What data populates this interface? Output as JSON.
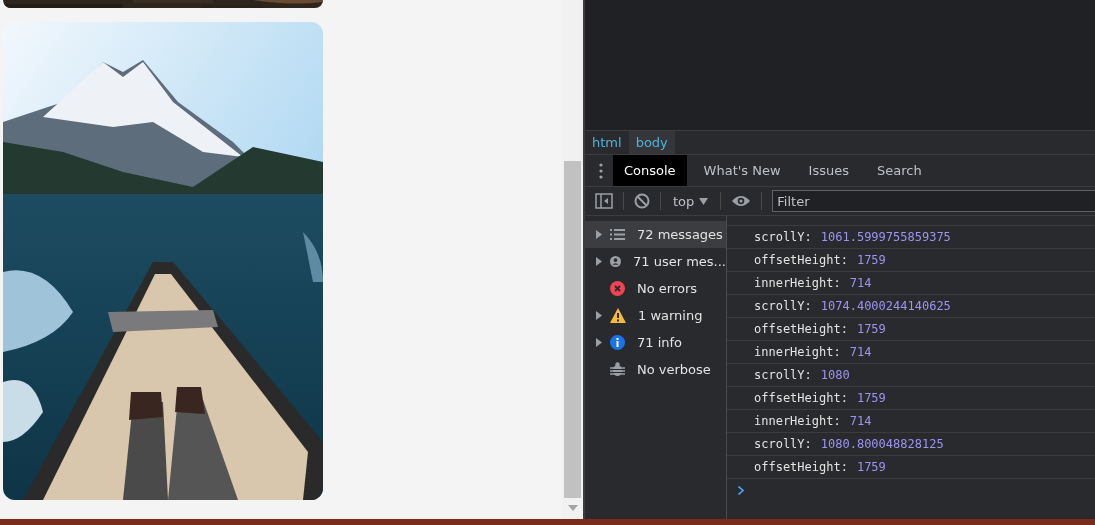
{
  "devtools": {
    "breadcrumbs": [
      {
        "label": "html",
        "selected": false
      },
      {
        "label": "body",
        "selected": true
      }
    ],
    "tabs": [
      {
        "label": "Console",
        "selected": true
      },
      {
        "label": "What's New",
        "selected": false
      },
      {
        "label": "Issues",
        "selected": false
      },
      {
        "label": "Search",
        "selected": false
      }
    ],
    "toolbar": {
      "context": "top",
      "filter_placeholder": "Filter"
    },
    "sidebar": [
      {
        "kind": "list",
        "label": "72 messages",
        "expandable": true,
        "selected": true
      },
      {
        "kind": "user",
        "label": "71 user mes...",
        "expandable": true,
        "selected": false
      },
      {
        "kind": "error",
        "label": "No errors",
        "expandable": false,
        "selected": false
      },
      {
        "kind": "warning",
        "label": "1 warning",
        "expandable": true,
        "selected": false
      },
      {
        "kind": "info",
        "label": "71 info",
        "expandable": true,
        "selected": false
      },
      {
        "kind": "verbose",
        "label": "No verbose",
        "expandable": false,
        "selected": false
      }
    ],
    "log": [
      {
        "key": "scrollY:",
        "value": "1061.5999755859375"
      },
      {
        "key": "offsetHeight:",
        "value": "1759"
      },
      {
        "key": "innerHeight:",
        "value": "714"
      },
      {
        "key": "scrollY:",
        "value": "1074.4000244140625"
      },
      {
        "key": "offsetHeight:",
        "value": "1759"
      },
      {
        "key": "innerHeight:",
        "value": "714"
      },
      {
        "key": "scrollY:",
        "value": "1080"
      },
      {
        "key": "offsetHeight:",
        "value": "1759"
      },
      {
        "key": "innerHeight:",
        "value": "714"
      },
      {
        "key": "scrollY:",
        "value": "1080.800048828125"
      },
      {
        "key": "offsetHeight:",
        "value": "1759"
      }
    ]
  }
}
